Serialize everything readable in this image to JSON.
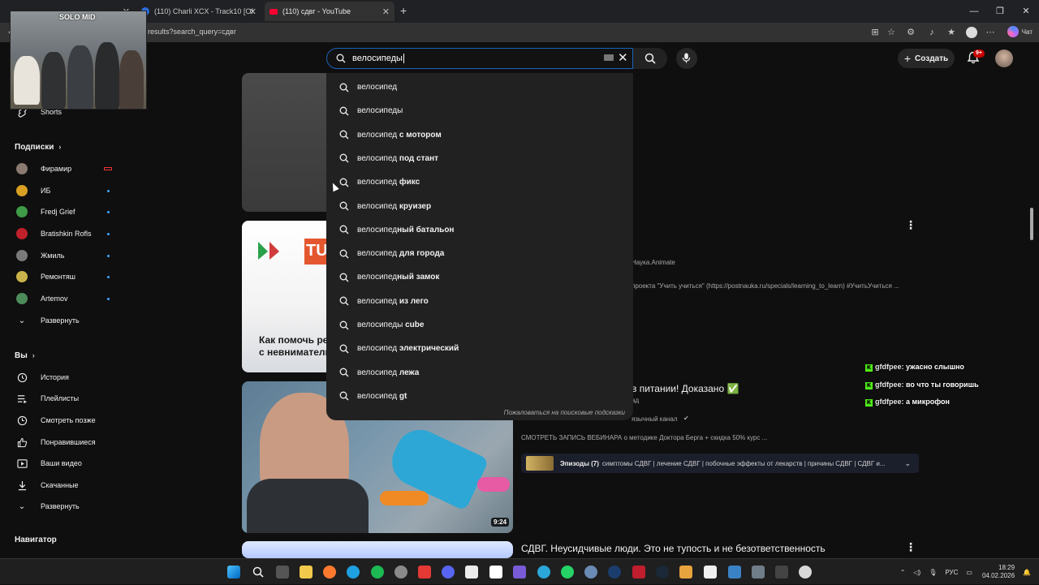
{
  "browser": {
    "tabs": [
      {
        "label": "",
        "active": false
      },
      {
        "label": "(110) Charli XCX - Track10 [Of",
        "active": false
      },
      {
        "label": "(110) сдвг - YouTube",
        "active": true
      }
    ],
    "url": "results?search_query=сдвг",
    "chat_label": "Чат"
  },
  "webcam": {
    "label": "SOLO MID"
  },
  "header": {
    "search_value": "велосипеды",
    "create_label": "Создать",
    "notif_badge": "9+"
  },
  "suggestions": [
    {
      "prefix": "велосипед",
      "suffix": ""
    },
    {
      "prefix": "велосипеды",
      "suffix": ""
    },
    {
      "prefix": "велосипед",
      "suffix": " с мотором"
    },
    {
      "prefix": "велосипед",
      "suffix": " под стант"
    },
    {
      "prefix": "велосипед",
      "suffix": " фикс"
    },
    {
      "prefix": "велосипед",
      "suffix": " круизер"
    },
    {
      "prefix": "велосипед",
      "suffix": "ный батальон"
    },
    {
      "prefix": "велосипед",
      "suffix": " для города"
    },
    {
      "prefix": "велосипед",
      "suffix": "ный замок"
    },
    {
      "prefix": "велосипед",
      "suffix": " из лего"
    },
    {
      "prefix": "велосипеды",
      "suffix": " cube"
    },
    {
      "prefix": "велосипед",
      "suffix": " электрический"
    },
    {
      "prefix": "велосипед",
      "suffix": " лежа"
    },
    {
      "prefix": "велосипед",
      "suffix": " gt"
    }
  ],
  "report_label": "Пожаловаться на поисковые подсказки",
  "sidebar": {
    "shorts": "Shorts",
    "subs_title": "Подписки",
    "channels": [
      {
        "name": "Фирамир",
        "color": "#8a7a70",
        "live": true
      },
      {
        "name": "ИБ",
        "color": "#d9a021",
        "live": false
      },
      {
        "name": "Fredj Grief",
        "color": "#3e9b47",
        "live": false
      },
      {
        "name": "Bratishkin Rofls",
        "color": "#c0202b",
        "live": false
      },
      {
        "name": "Жмиль",
        "color": "#7a7a7a",
        "live": false
      },
      {
        "name": "Ремонтяш",
        "color": "#c9b24a",
        "live": false
      },
      {
        "name": "Artemov",
        "color": "#4d8b5a",
        "live": false
      }
    ],
    "expand1": "Развернуть",
    "you_title": "Вы",
    "you_items": [
      {
        "label": "История",
        "icon": "history-icon"
      },
      {
        "label": "Плейлисты",
        "icon": "playlists-icon"
      },
      {
        "label": "Смотреть позже",
        "icon": "watch-later-icon"
      },
      {
        "label": "Понравившиеся",
        "icon": "like-icon"
      },
      {
        "label": "Ваши видео",
        "icon": "your-videos-icon"
      },
      {
        "label": "Скачанные",
        "icon": "download-icon"
      }
    ],
    "expand2": "Развернуть",
    "nav_title": "Навигатор"
  },
  "videos": {
    "v2_channel": "Наука.Animate",
    "v2_desc": "проекта \"Учить учиться\" (https://postnauka.ru/specials/learning_to_learn) #УчитьУчиться ...",
    "v2_thumb_title_1": "Как помочь реб",
    "v2_thumb_title_2": "с невнимательн",
    "v3_title_tail": "в питании! Доказано ✅",
    "v3_meta_tail": "ад",
    "v3_channel": "язычный канал",
    "v3_desc": "СМОТРЕТЬ ЗАПИСЬ ВЕБИНАРА о методике Доктора Берга + скидка 50% курс ...",
    "v3_duration": "9:24",
    "episodes_label": "Эпизоды (7)",
    "episodes_desc": "симптомы СДВГ | лечение СДВГ | побочные эффекты от лекарств | причины СДВГ | СДВГ и...",
    "v4_title": "СДВГ. Неусидчивые люди. Это не тупость и не безответственность"
  },
  "chat": [
    {
      "user": "gfdfpee:",
      "msg": " ужасно слышно"
    },
    {
      "user": "gfdfpee:",
      "msg": " во что ты говоришь"
    },
    {
      "user": "gfdfpee:",
      "msg": " а микрофон"
    }
  ],
  "tray": {
    "lang": "РУС",
    "time": "18:29",
    "date": "04.02.2026"
  },
  "colors": {
    "accent": "#3ea6ff",
    "badge": "#cc0000",
    "search_border": "#1c62b9"
  }
}
